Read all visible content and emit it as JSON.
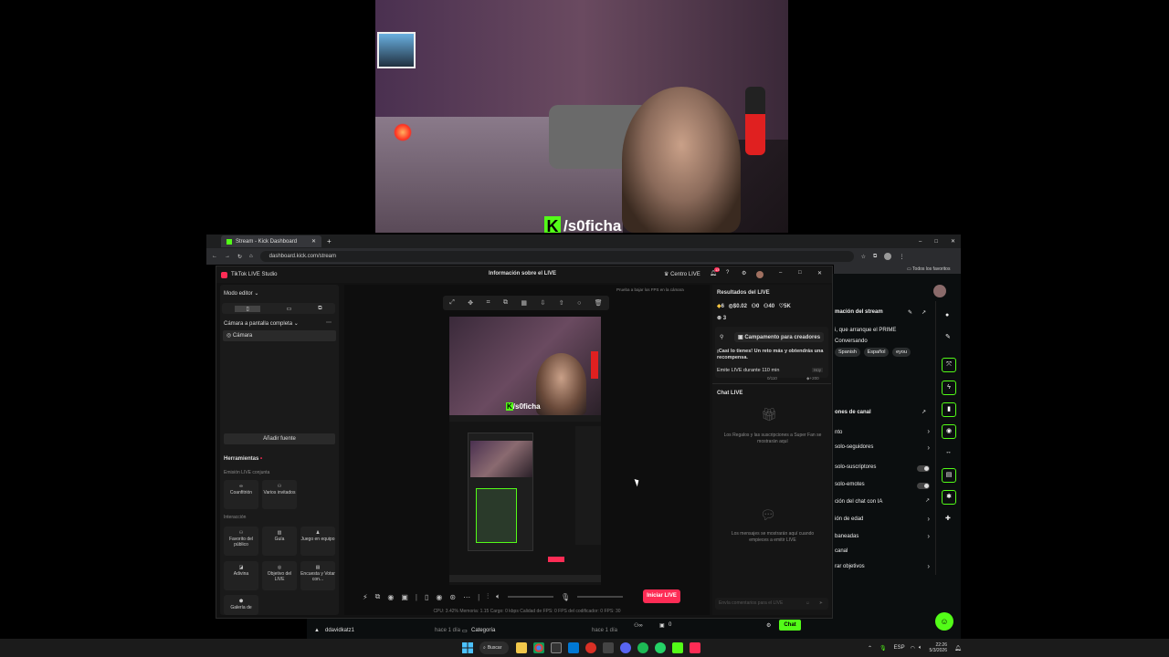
{
  "webcam": {
    "streamer_name": "/s0ficha"
  },
  "browser": {
    "tab_title": "Stream - Kick Dashboard",
    "url": "dashboard.kick.com/stream",
    "bookmarks_label": "Todos los favoritos"
  },
  "tiktok": {
    "app_title": "TikTok LIVE Studio",
    "window_title": "Información sobre el LIVE",
    "creator_center": "Centro LIVE",
    "notif_count": "13",
    "editor_mode": "Modo editor",
    "scene_name": "Cámara a pantalla completa",
    "source_camera": "Cámara",
    "add_source": "Añadir fuente",
    "tools_heading": "Herramientas",
    "joint_live": "Emisión LIVE conjunta",
    "tools": {
      "cohost": "Coanfitrión",
      "multi_guest": "Varios invitados",
      "interaction": "Interacción",
      "favorite": "Favorito del público",
      "guide": "Guía",
      "team_game": "Juego en equipo",
      "guess": "Adivina",
      "live_goal": "Objetivo del LIVE",
      "poll": "Encuesta y Votar con...",
      "gallery": "Galería de"
    },
    "preview_hint": "Prueba a bajar los FPS en la cámara",
    "results_heading": "Resultados del LIVE",
    "stats": {
      "diamonds": "6",
      "earnings": "$0.02",
      "viewers": "0",
      "shares": "40",
      "likes": "5K",
      "gifters": "3"
    },
    "camp": "Campamento para creadores",
    "camp_desc": "¡Casi lo tienes! Un reto más y obtendrás una recompensa.",
    "camp_task": "Emite LIVE durante 110 min",
    "camp_progress": "0/110",
    "camp_reward": "+200",
    "camp_today": "Hoy",
    "chat_heading": "Chat LIVE",
    "chat_gifts_msg": "Los Regalos y las suscripciones a Super Fan se mostrarán aquí",
    "chat_msgs_msg": "Los mensajes se mostrarán aquí cuando empieces a emitir LIVE",
    "chat_input_placeholder": "Envía comentarios para el LIVE",
    "go_live": "Iniciar LIVE",
    "perf_stats": "CPU: 3.42%     Memoria: 1.15     Cargo: 0 kbps     Calidad de FPS: 0     FPS del codificador: 0     FPS: 30"
  },
  "kick": {
    "stream_info_title": "mación del stream",
    "stream_title_value": "i, que arranque el PRIME",
    "category_value": "Conversando",
    "tags": [
      "Spanish",
      "Español",
      "eyou"
    ],
    "channel_options": "ones de canal",
    "rows": [
      "nto",
      "solo-seguidores",
      "solo-suscriptores",
      "solo-emotes",
      "ción del chat con IA",
      "ión de edad",
      "baneadas",
      "canal",
      "rar objetivos"
    ],
    "chat_button": "Chat",
    "bottom_user": "ddavidkatz1",
    "bottom_time": "hace 1 día",
    "bottom_category": "Categoría",
    "bottom_time2": "hace 1 día",
    "viewer_count": "0"
  },
  "taskbar": {
    "search": "Buscar",
    "lang": "ESP",
    "time": "22:26",
    "date": "5/3/2026"
  },
  "colors": {
    "kick_green": "#53fc18",
    "tiktok_pink": "#fe2c55"
  }
}
